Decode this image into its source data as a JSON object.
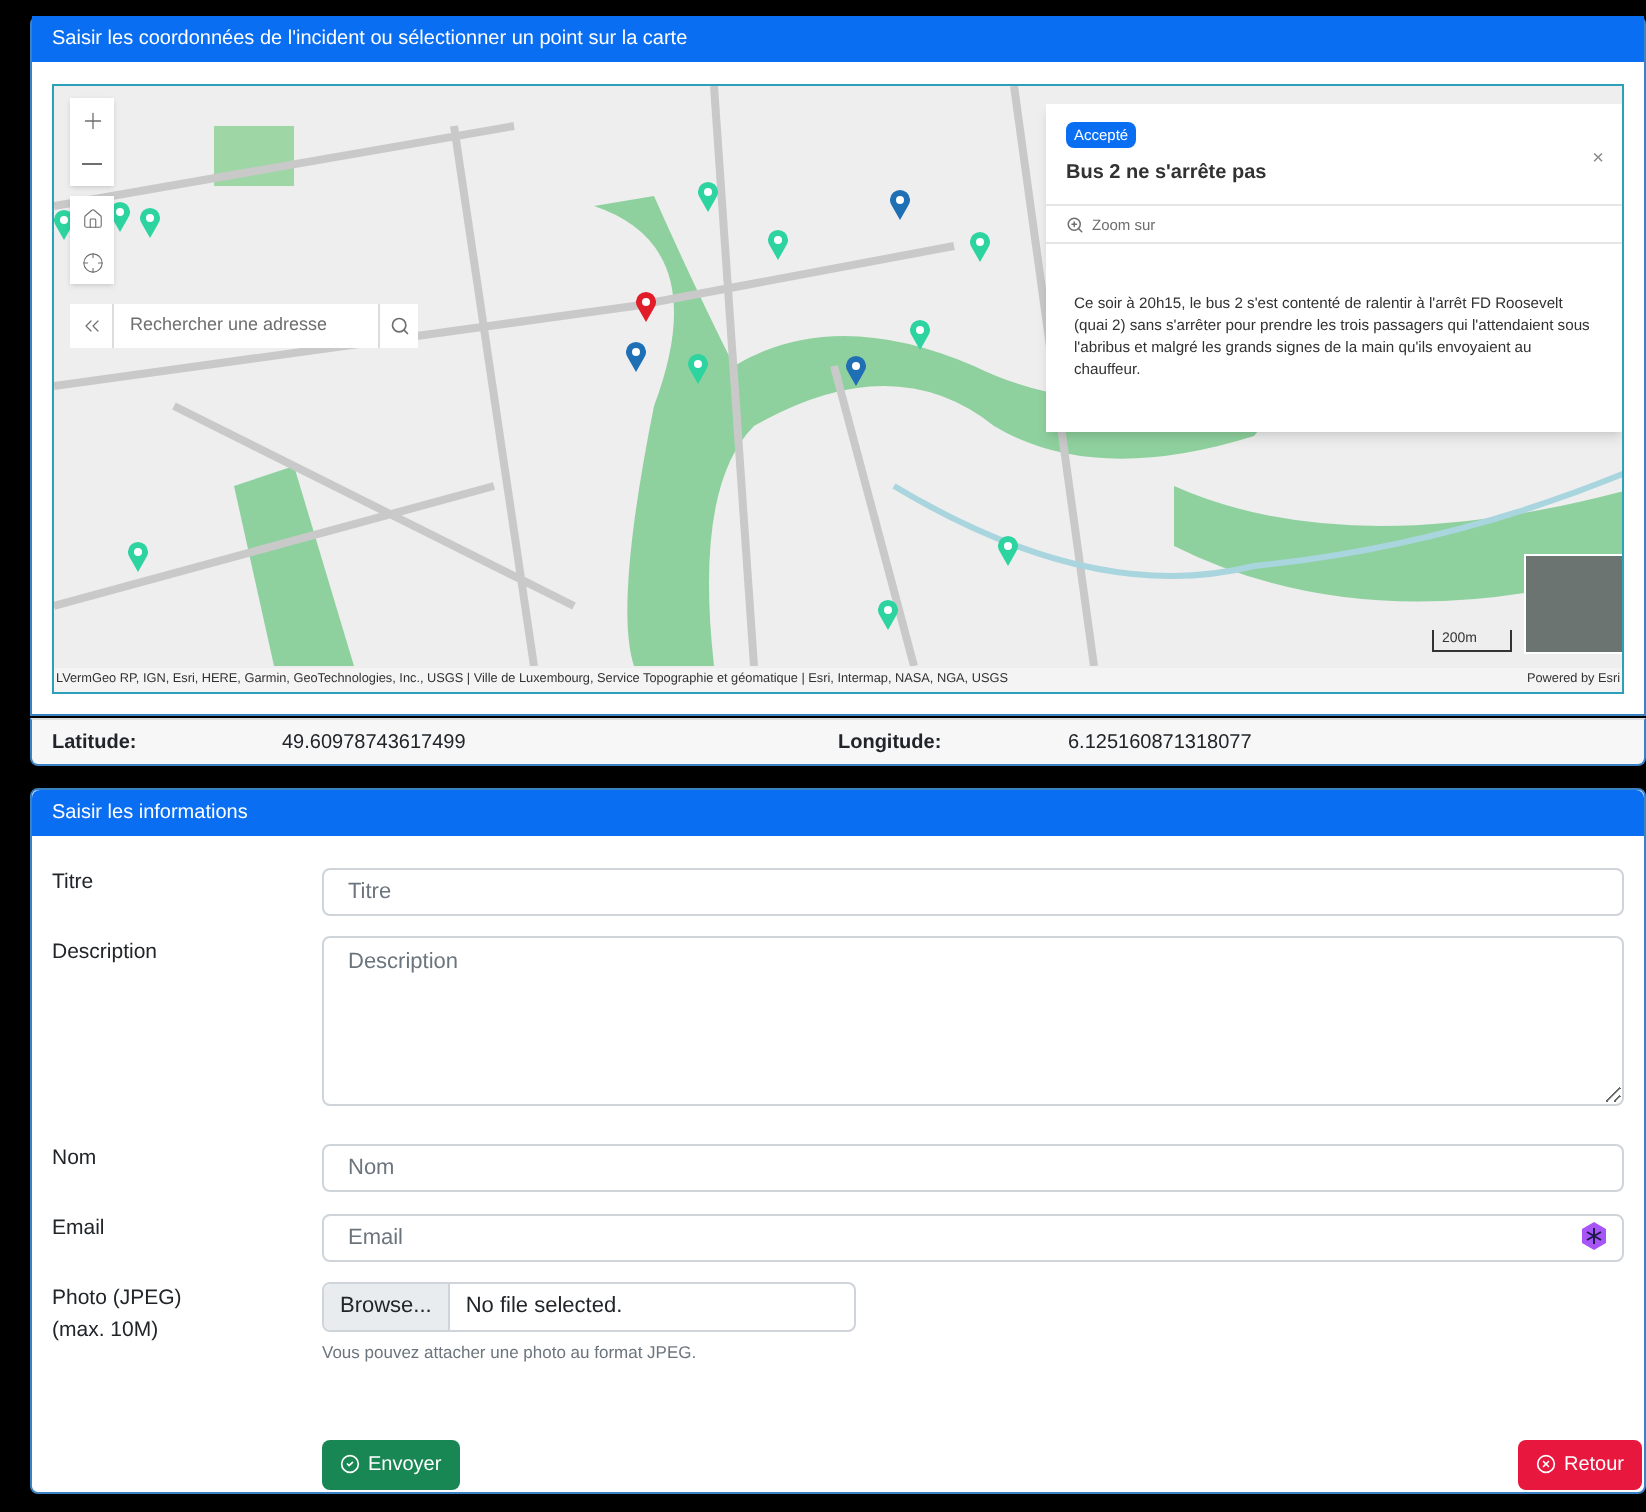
{
  "location_panel": {
    "title": "Saisir les coordonnées de l'incident ou sélectionner un point sur la carte"
  },
  "map": {
    "search": {
      "placeholder": "Rechercher une adresse"
    },
    "popup": {
      "badge": "Accepté",
      "title": "Bus 2 ne s'arrête pas",
      "close": "×",
      "action": "Zoom sur",
      "body": "Ce soir à 20h15, le bus 2 s'est contenté de ralentir à l'arrêt FD Roosevelt (quai 2) sans s'arrêter pour prendre les trois passagers qui l'attendaient sous l'abribus et malgré les grands signes de la main qu'ils envoyaient au chauffeur."
    },
    "attribution": "LVermGeo RP, IGN, Esri, HERE, Garmin, GeoTechnologies, Inc., USGS | Ville de Luxembourg, Service Topographie et géomatique | Esri, Intermap, NASA, NGA, USGS",
    "powered_by": "Powered by Esri",
    "scale": "200m"
  },
  "coordinates": [
    {
      "label": "Latitude:",
      "value": "49.60978743617499"
    },
    {
      "label": "Longitude:",
      "value": "6.125160871318077"
    }
  ],
  "info_panel": {
    "title": "Saisir les informations",
    "fields": [
      {
        "kind": "text",
        "label": "Titre",
        "placeholder": "Titre"
      },
      {
        "kind": "textarea",
        "label": "Description",
        "placeholder": "Description"
      },
      {
        "kind": "text",
        "label": "Nom",
        "placeholder": "Nom"
      },
      {
        "kind": "email",
        "label": "Email",
        "placeholder": "Email"
      },
      {
        "kind": "file",
        "label": "Photo (JPEG)\n(max. 10M)",
        "button": "Browse...",
        "value": "No file selected.",
        "hint": "Vous pouvez attacher une photo au format JPEG."
      }
    ],
    "buttons": [
      {
        "kind": "submit",
        "label": "Envoyer"
      },
      {
        "kind": "back",
        "label": "Retour"
      }
    ]
  }
}
